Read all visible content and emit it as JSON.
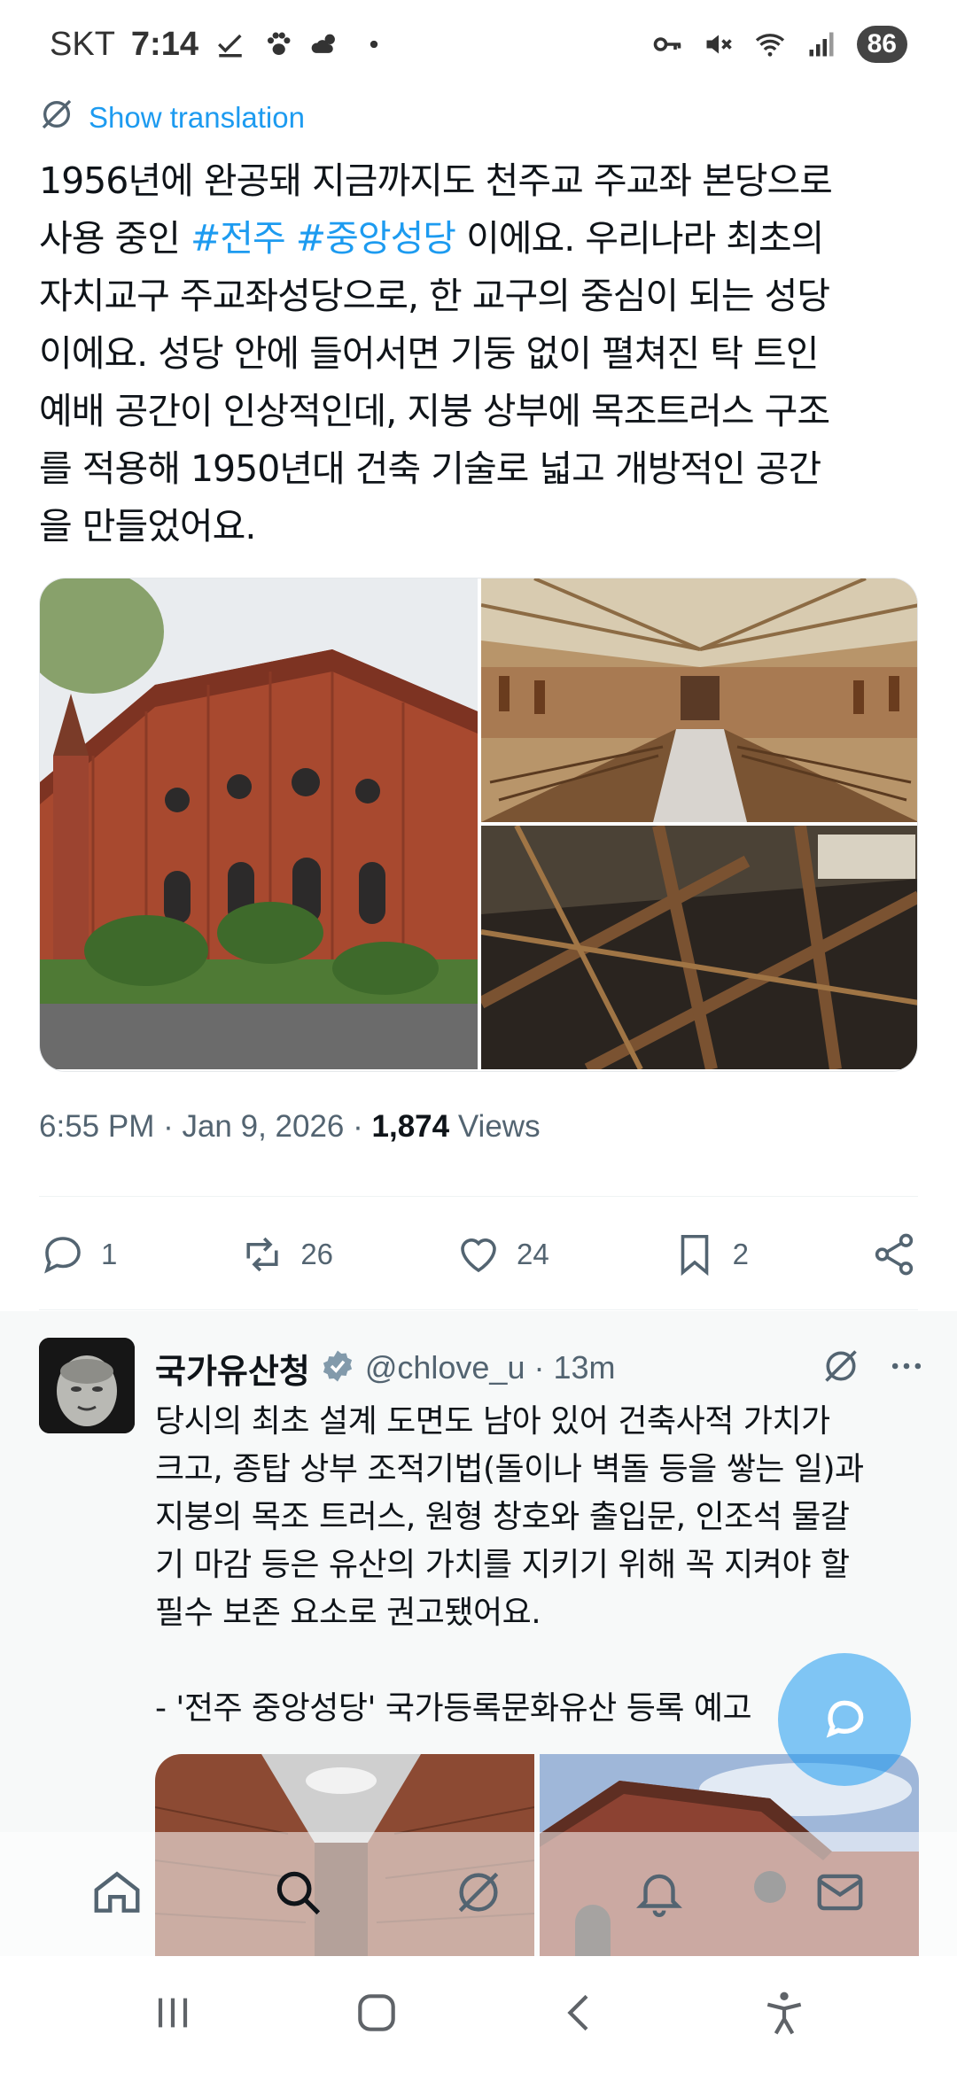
{
  "status_bar": {
    "carrier": "SKT",
    "time": "7:14",
    "battery": "86",
    "icons": [
      "check-icon",
      "paw-icon",
      "weather-icon",
      "dot-icon",
      "key-icon",
      "mute-icon",
      "wifi-icon",
      "signal-icon"
    ]
  },
  "tweet": {
    "translate_label": "Show translation",
    "text_before": "1956년에 완공돼 지금까지도 천주교 주교좌 본당으로\n사용 중인 ",
    "hashtag1": "#전주",
    "hashtag2": "#중앙성당",
    "text_after": " 이에요. 우리나라 최초의\n자치교구 주교좌성당으로, 한 교구의 중심이 되는 성당\n이에요. 성당 안에 들어서면 기둥 없이 펼쳐진 탁 트인\n예배 공간이 인상적인데, 지붕 상부에 목조트러스 구조\n를 적용해 1950년대 건축 기술로 넓고 개방적인 공간\n을 만들었어요.",
    "time": "6:55 PM",
    "date": "Jan 9, 2026",
    "views_count": "1,874",
    "views_label": "Views",
    "replies": "1",
    "reposts": "26",
    "likes": "24",
    "bookmarks": "2"
  },
  "reply": {
    "name": "국가유산청",
    "handle": "@chlove_u",
    "time": "13m",
    "text": "당시의 최초 설계 도면도 남아 있어 건축사적 가치가\n크고, 종탑 상부 조적기법(돌이나 벽돌 등을 쌓는 일)과\n지붕의 목조 트러스, 원형 창호와 출입문, 인조석 물갈\n기 마감 등은 유산의 가치를 지키기 위해 꼭 지켜야 할\n필수 보존 요소로 권고됐어요.\n\n- '전주 중앙성당' 국가등록문화유산 등록 예고"
  },
  "colors": {
    "accent": "#1d9bf0",
    "text": "#0f1419",
    "muted": "#536471",
    "brick": "#a8492f"
  }
}
